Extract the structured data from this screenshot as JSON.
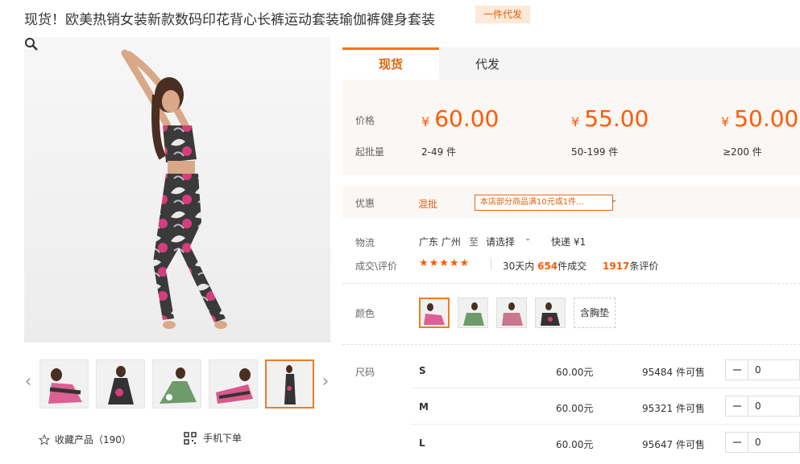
{
  "product": {
    "title": "现货！欧美热销女装新款数码印花背心长裤运动套装瑜伽裤健身套装",
    "badge": "一件代发"
  },
  "gallery": {
    "prev_arrow": "‹",
    "next_arrow": "›",
    "active_thumb": 5
  },
  "actions": {
    "favorite_label": "收藏产品（190）",
    "mobile_label": "手机下单"
  },
  "tabs": [
    {
      "label": "现货"
    },
    {
      "label": "代发"
    }
  ],
  "pricing": {
    "price_label": "价格",
    "moq_label": "起批量",
    "currency": "¥",
    "tiers": [
      {
        "price": "60.00",
        "range": "2-49 件"
      },
      {
        "price": "55.00",
        "range": "50-199 件"
      },
      {
        "price": "50.00",
        "range": "≥200 件"
      }
    ]
  },
  "promo": {
    "label": "优惠",
    "tag": "混批",
    "text": "本店部分商品满10元或1件...",
    "chevron": "⌄"
  },
  "logistics": {
    "label": "物流",
    "origin": "广东 广州",
    "to": "至",
    "destination": "请选择",
    "express": "快递 ¥1"
  },
  "reviews": {
    "label": "成交\\评价",
    "stars": "★★★★★",
    "sales_prefix": "30天内",
    "sales_count": "654",
    "sales_suffix": "件成交",
    "review_count": "1917",
    "review_suffix": "条评价"
  },
  "color": {
    "label": "颜色",
    "options_count": 4,
    "text_option": "含胸垫"
  },
  "sizes": {
    "label": "尺码",
    "rows": [
      {
        "name": "S",
        "price": "60.00元",
        "stock": "95484 件可售",
        "qty": "0"
      },
      {
        "name": "M",
        "price": "60.00元",
        "stock": "95321 件可售",
        "qty": "0"
      },
      {
        "name": "L",
        "price": "60.00元",
        "stock": "95647 件可售",
        "qty": "0"
      }
    ]
  },
  "colors": {
    "accent": "#ff5a00",
    "accent_dark": "#e0620d",
    "panel_bg": "#fbf7f4",
    "badge_bg": "#fde9d8"
  }
}
